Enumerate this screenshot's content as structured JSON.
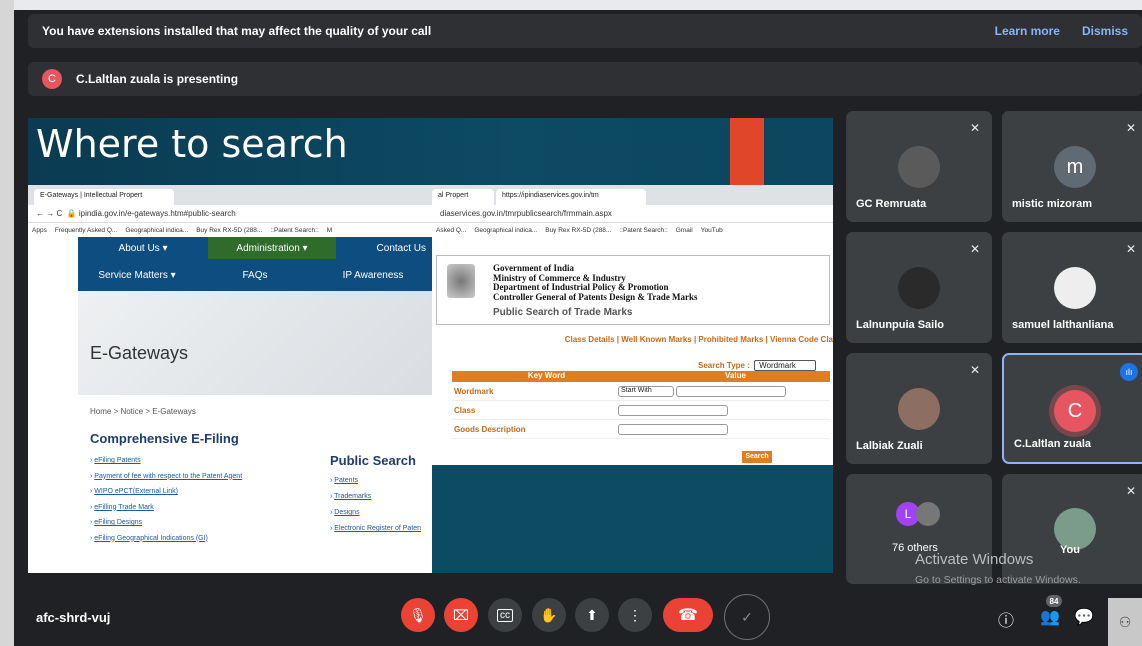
{
  "banner": {
    "message": "You have extensions installed that may affect the quality of your call",
    "learn_more": "Learn more",
    "dismiss": "Dismiss"
  },
  "presenting": {
    "initial": "C",
    "text": "C.Laltlan zuala is presenting"
  },
  "slide": {
    "title": "Where to search",
    "left_browser": {
      "tab_label": "E-Gateways | Intellectual Propert",
      "url": "ipindia.gov.in/e-gateways.htm#public-search",
      "bookmarks": [
        "Apps",
        "Frequently Asked Q...",
        "Geographical indica...",
        "Buy Rex RX-5D (288...",
        "::Patent Search::",
        "M"
      ],
      "nav_top": [
        "About Us ▾",
        "Administration ▾",
        "Contact Us"
      ],
      "nav_main": [
        "Service Matters ▾",
        "FAQs",
        "IP Awareness"
      ],
      "banner_title": "E-Gateways",
      "breadcrumb": "Home  >  Notice  >  E-Gateways",
      "section_title": "Comprehensive E-Filing",
      "links": [
        "eFiling Patents",
        "Payment of fee with respect to the Patent Agent",
        "WIPO ePCT(External Link)",
        "eFilling Trade Mark",
        "eFiling Designs",
        "eFiling Geographical Indications (GI)"
      ],
      "public_title": "Public Search",
      "public_links": [
        "Patents",
        "Trademarks",
        "Designs",
        "Electronic Register of Paten"
      ]
    },
    "right_browser": {
      "tab1": "al Propert",
      "tab2": "https://ipindiaservices.gov.in/tm",
      "url": "diaservices.gov.in/tmrpublicsearch/frmmain.aspx",
      "bookmarks": [
        "Asked Q...",
        "Geographical indica...",
        "Buy Rex RX-5D (288...",
        "::Patent Search::",
        "Gmail",
        "YouTub"
      ],
      "gov_lines": [
        "Government of India",
        "Ministry of Commerce & Industry",
        "Department of Industrial Policy & Promotion",
        "Controller General of Patents Design & Trade Marks"
      ],
      "page_title": "Public Search of Trade Marks",
      "links": "Class Details | Well Known Marks | Prohibited Marks | Vienna Code Cla",
      "search_type_label": "Search Type :",
      "search_type_value": "Wordmark",
      "col_keyword": "Key Word",
      "col_value": "Value",
      "row_wordmark": "Wordmark",
      "start_with": "Start With",
      "row_class": "Class",
      "row_goods": "Goods Description",
      "search_btn": "Search"
    }
  },
  "participants": [
    {
      "name": "GC Remruata",
      "initial": "",
      "muted": true
    },
    {
      "name": "mistic mizoram",
      "initial": "m",
      "muted": true
    },
    {
      "name": "Lalnunpuia Sailo",
      "initial": "",
      "muted": true
    },
    {
      "name": "samuel lalthanliana",
      "initial": "",
      "muted": true
    },
    {
      "name": "Lalbiak Zuali",
      "initial": "",
      "muted": true
    },
    {
      "name": "C.Laltlan zuala",
      "initial": "C",
      "muted": false
    },
    {
      "name": "76 others",
      "initial": "L",
      "muted": false
    },
    {
      "name": "You",
      "initial": "",
      "muted": true
    }
  ],
  "watermark": {
    "line1": "Activate Windows",
    "line2": "Go to Settings to activate Windows."
  },
  "bottom": {
    "meeting_code": "afc-shrd-vuj",
    "people_count": "84"
  },
  "colors": {
    "bg": "#202124",
    "tile": "#3c4043",
    "danger": "#ea4335",
    "link": "#8ab4f8",
    "active": "#1a73e8"
  }
}
